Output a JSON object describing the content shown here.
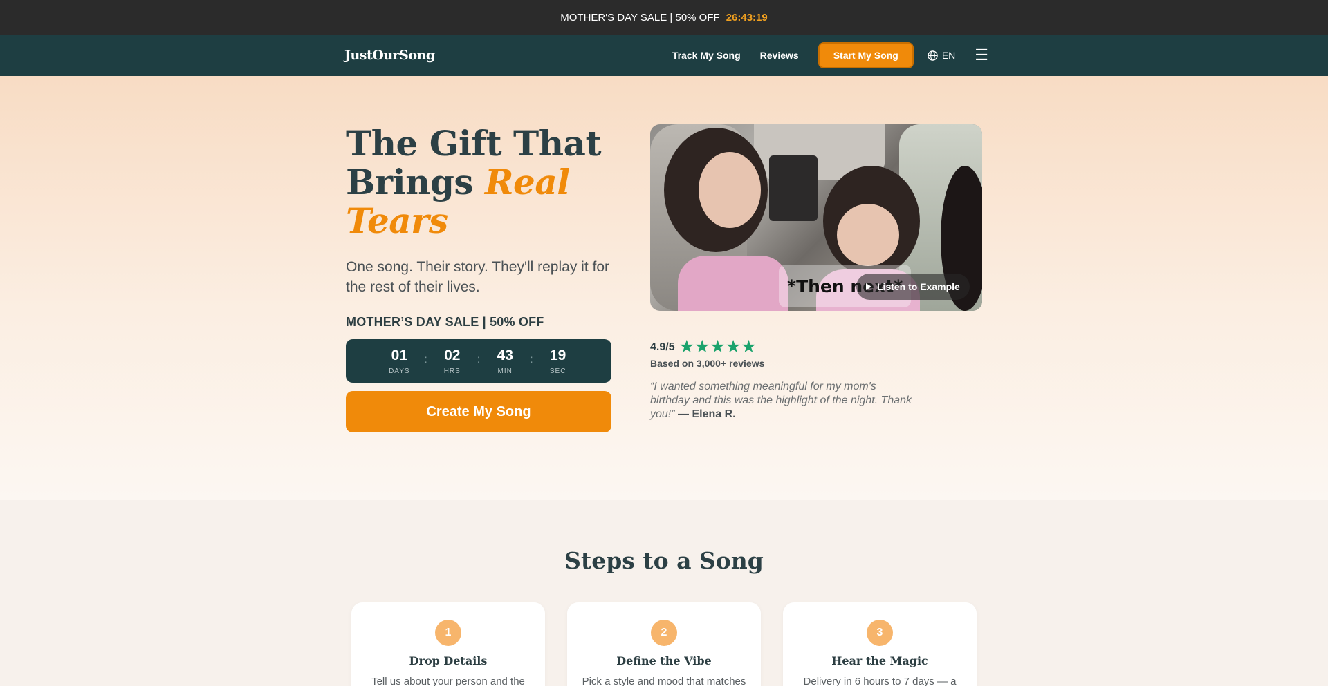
{
  "promo": {
    "text": "MOTHER'S DAY SALE | 50% OFF",
    "timer": "26:43:19"
  },
  "nav": {
    "logo": "JustOurSong",
    "track": "Track My Song",
    "reviews": "Reviews",
    "cta": "Start My Song",
    "lang": "EN",
    "menu_icon": "hamburger-menu-icon"
  },
  "hero": {
    "title_1": "The Gift That",
    "title_2": "Brings",
    "title_accent": "Real Tears",
    "subtitle": "One song. Their story. They'll replay it for the rest of their lives.",
    "sale_label": "MOTHER’S DAY SALE | 50% OFF",
    "countdown": [
      {
        "value": "01",
        "label": "DAYS"
      },
      {
        "value": "02",
        "label": "HRS"
      },
      {
        "value": "43",
        "label": "MIN"
      },
      {
        "value": "19",
        "label": "SEC"
      }
    ],
    "countdown_sep": ":",
    "create_btn": "Create My Song"
  },
  "video": {
    "caption": "*Then next*",
    "listen_btn": "Listen to Example"
  },
  "rating": {
    "score": "4.9/5",
    "stars": 5,
    "stars_text": "★★★★★",
    "based_on": "Based on 3,000+ reviews",
    "star_color": "#1aa36c"
  },
  "testimonial": {
    "quote": "“I wanted something meaningful for my mom's birthday and this was the highlight of the night. Thank you!”",
    "author": "— Elena R."
  },
  "steps": {
    "title": "Steps to a Song",
    "items": [
      {
        "num": "1",
        "title": "Drop Details",
        "text": "Tell us about your person and the"
      },
      {
        "num": "2",
        "title": "Define the Vibe",
        "text": "Pick a style and mood that matches"
      },
      {
        "num": "3",
        "title": "Hear the Magic",
        "text": "Delivery in 6 hours to 7 days — a"
      }
    ]
  },
  "colors": {
    "accent": "#f08a0a",
    "nav_bg": "#1e3e42",
    "promo_bg": "#2b2b2b",
    "badge": "#f7b56c"
  }
}
